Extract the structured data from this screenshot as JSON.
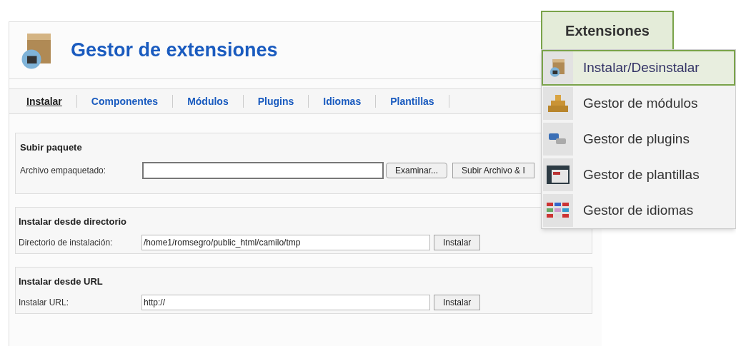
{
  "page": {
    "title": "Gestor de extensiones"
  },
  "tabs": [
    {
      "label": "Instalar",
      "selected": true
    },
    {
      "label": "Componentes",
      "selected": false
    },
    {
      "label": "Módulos",
      "selected": false
    },
    {
      "label": "Plugins",
      "selected": false
    },
    {
      "label": "Idiomas",
      "selected": false
    },
    {
      "label": "Plantillas",
      "selected": false
    }
  ],
  "upload": {
    "heading": "Subir paquete",
    "label": "Archivo empaquetado:",
    "browse_button": "Examinar...",
    "submit_button": "Subir Archivo & I"
  },
  "directory": {
    "heading": "Instalar desde directorio",
    "label": "Directorio de instalación:",
    "value": "/home1/romsegro/public_html/camilo/tmp",
    "button": "Instalar"
  },
  "url": {
    "heading": "Instalar desde URL",
    "label": "Instalar URL:",
    "value": "http://",
    "button": "Instalar"
  },
  "menu": {
    "title": "Extensiones",
    "items": [
      {
        "label": "Instalar/Desinstalar",
        "kind": "install",
        "selected": true
      },
      {
        "label": "Gestor de módulos",
        "kind": "modules",
        "selected": false
      },
      {
        "label": "Gestor de plugins",
        "kind": "plugins",
        "selected": false
      },
      {
        "label": "Gestor de plantillas",
        "kind": "templates",
        "selected": false
      },
      {
        "label": "Gestor de idiomas",
        "kind": "languages",
        "selected": false
      }
    ]
  }
}
